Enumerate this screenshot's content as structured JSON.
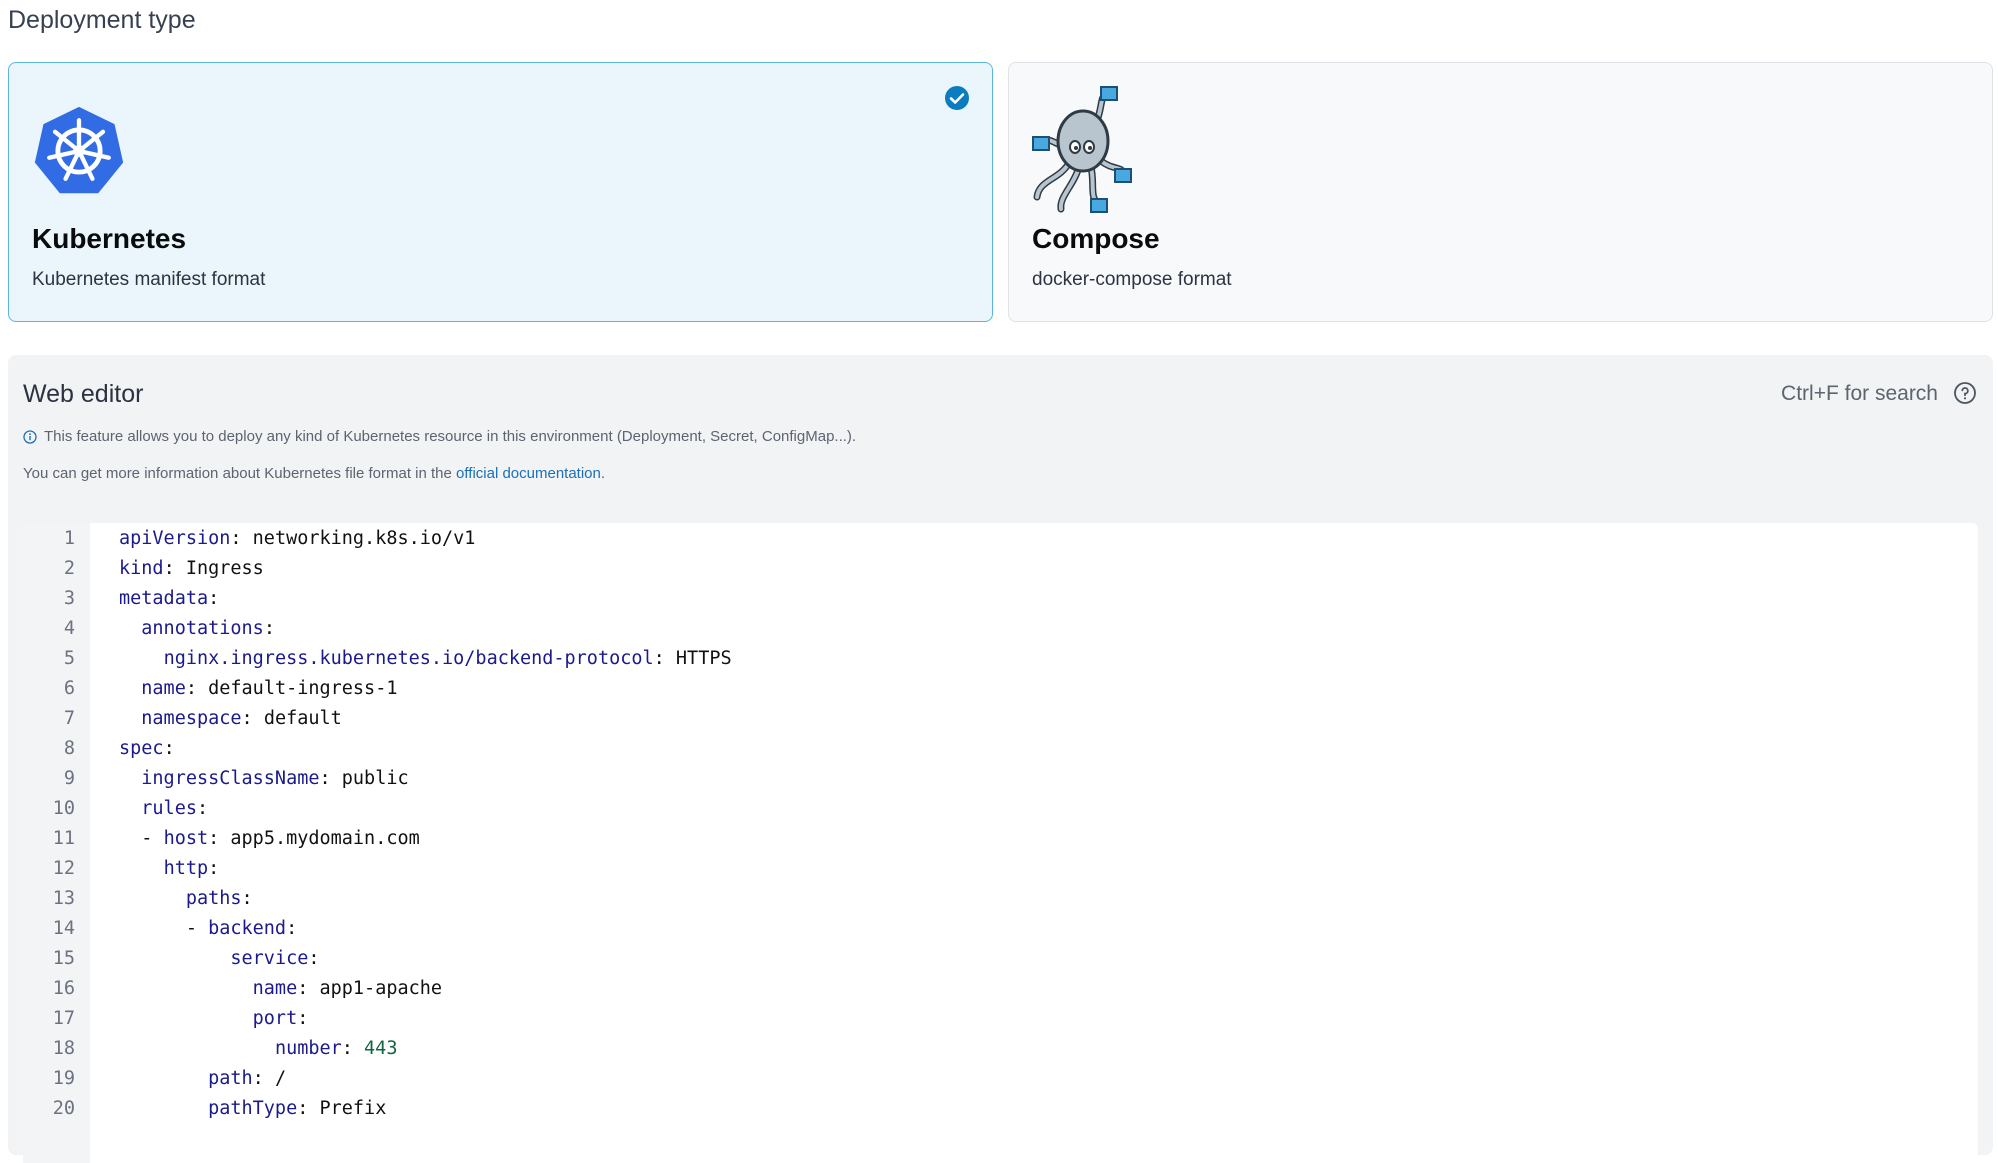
{
  "deployment": {
    "title": "Deployment type",
    "options": [
      {
        "name": "Kubernetes",
        "description": "Kubernetes manifest format",
        "selected": true,
        "icon": "kubernetes-logo-icon"
      },
      {
        "name": "Compose",
        "description": "docker-compose format",
        "selected": false,
        "icon": "docker-compose-octopus-icon"
      }
    ]
  },
  "editor": {
    "title": "Web editor",
    "search_hint": "Ctrl+F for search",
    "info_text": "This feature allows you to deploy any kind of Kubernetes resource in this environment (Deployment, Secret, ConfigMap...).",
    "doc_prefix": "You can get more information about Kubernetes file format in the ",
    "doc_link": "official documentation",
    "doc_suffix": ".",
    "lines": [
      {
        "no": "1",
        "indent": "",
        "key": "apiVersion",
        "value": "networking.k8s.io/v1"
      },
      {
        "no": "2",
        "indent": "",
        "key": "kind",
        "value": "Ingress"
      },
      {
        "no": "3",
        "indent": "",
        "key": "metadata",
        "value": ""
      },
      {
        "no": "4",
        "indent": "  ",
        "key": "annotations",
        "value": ""
      },
      {
        "no": "5",
        "indent": "    ",
        "key": "nginx.ingress.kubernetes.io/backend-protocol",
        "value": "HTTPS"
      },
      {
        "no": "6",
        "indent": "  ",
        "key": "name",
        "value": "default-ingress-1"
      },
      {
        "no": "7",
        "indent": "  ",
        "key": "namespace",
        "value": "default"
      },
      {
        "no": "8",
        "indent": "",
        "key": "spec",
        "value": ""
      },
      {
        "no": "9",
        "indent": "  ",
        "key": "ingressClassName",
        "value": "public"
      },
      {
        "no": "10",
        "indent": "  ",
        "key": "rules",
        "value": ""
      },
      {
        "no": "11",
        "indent": "  - ",
        "key": "host",
        "value": "app5.mydomain.com"
      },
      {
        "no": "12",
        "indent": "    ",
        "key": "http",
        "value": ""
      },
      {
        "no": "13",
        "indent": "      ",
        "key": "paths",
        "value": ""
      },
      {
        "no": "14",
        "indent": "      - ",
        "key": "backend",
        "value": ""
      },
      {
        "no": "15",
        "indent": "          ",
        "key": "service",
        "value": ""
      },
      {
        "no": "16",
        "indent": "            ",
        "key": "name",
        "value": "app1-apache"
      },
      {
        "no": "17",
        "indent": "            ",
        "key": "port",
        "value": ""
      },
      {
        "no": "18",
        "indent": "              ",
        "key": "number",
        "value": "443",
        "numeric": true
      },
      {
        "no": "19",
        "indent": "        ",
        "key": "path",
        "value": "/"
      },
      {
        "no": "20",
        "indent": "        ",
        "key": "pathType",
        "value": "Prefix"
      }
    ]
  },
  "colors": {
    "selected_border": "#5ab6e0",
    "selected_bg": "#eaf6fc",
    "check": "#0a7cc0",
    "kubernetes_blue": "#326ce5",
    "yaml_key": "#1a1a8c",
    "yaml_number": "#116644"
  }
}
